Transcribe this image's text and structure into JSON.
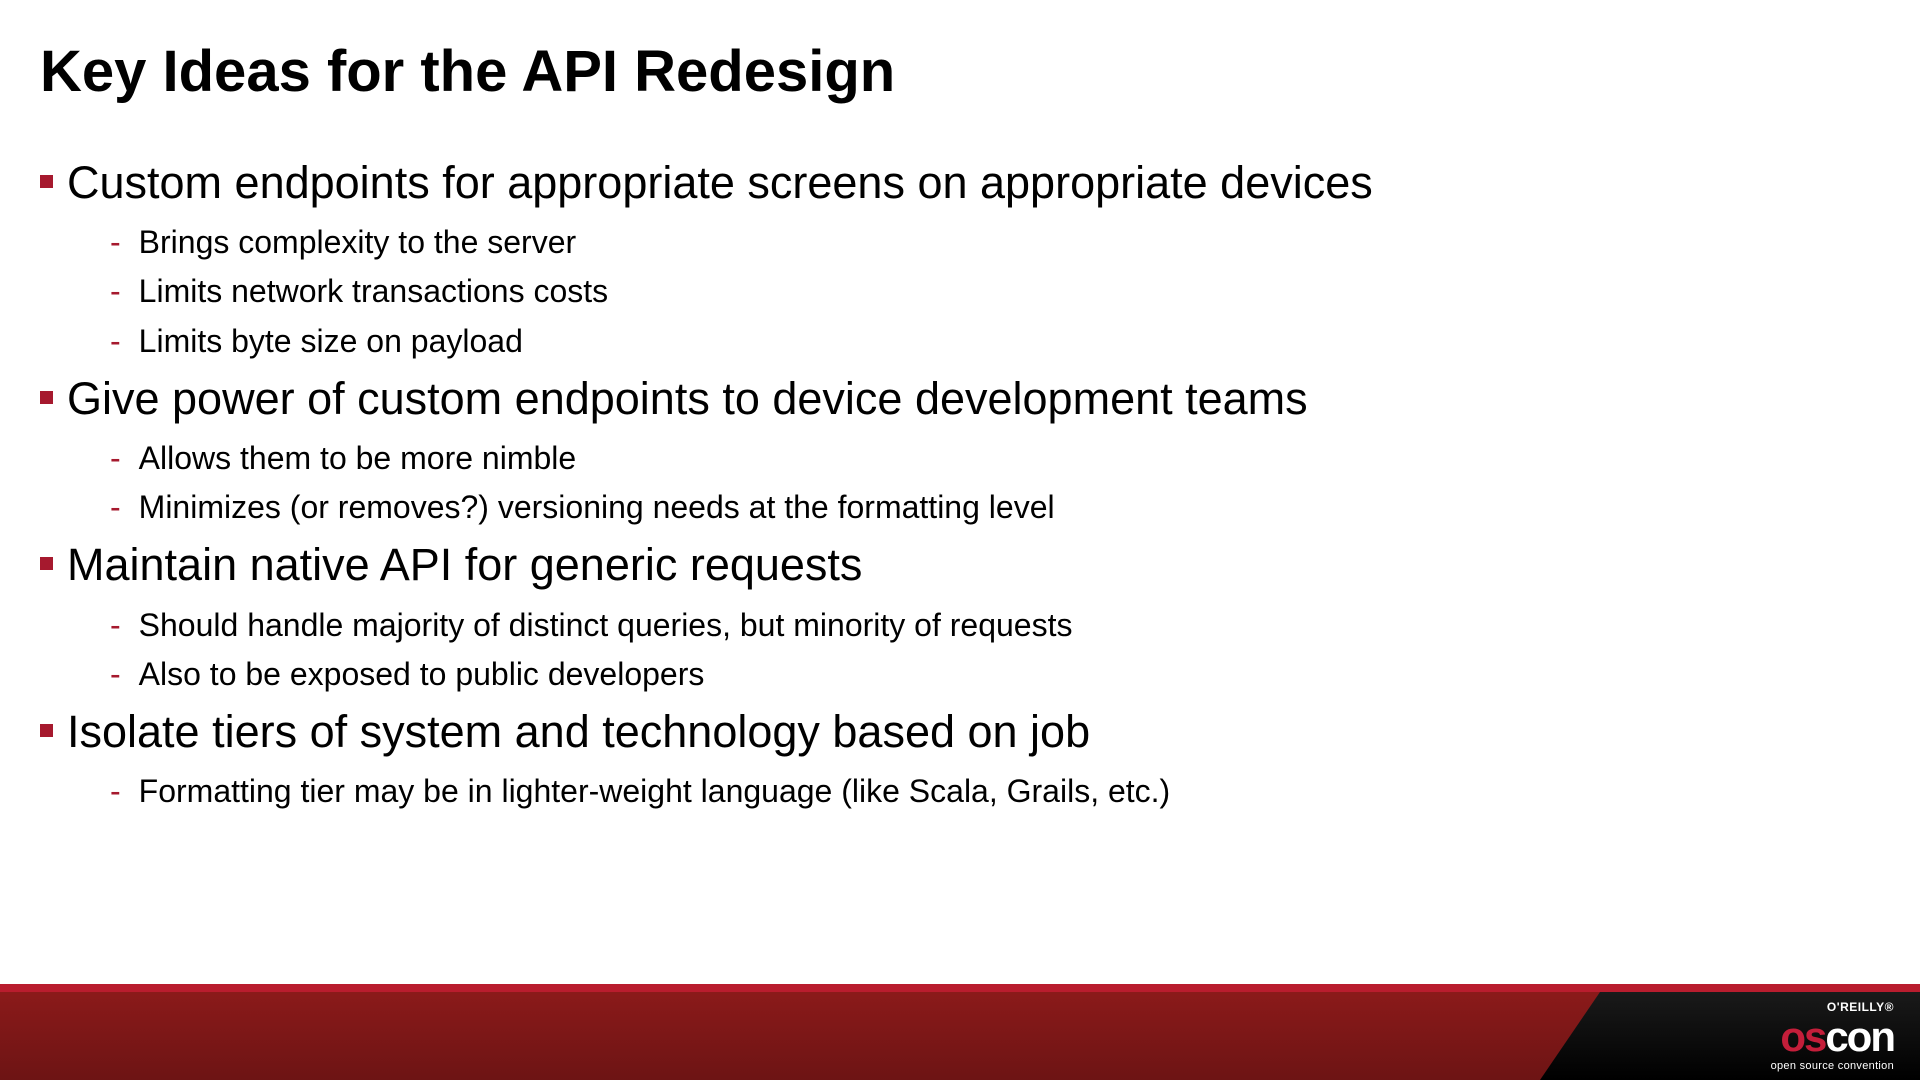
{
  "title": "Key Ideas for the API Redesign",
  "bullets": [
    {
      "main": "Custom endpoints for appropriate screens on appropriate devices",
      "subs": [
        "Brings complexity to the server",
        "Limits network transactions costs",
        "Limits byte size on payload"
      ]
    },
    {
      "main": "Give power of custom endpoints to device development teams",
      "subs": [
        "Allows them to be more nimble",
        "Minimizes (or removes?) versioning needs at the formatting level"
      ]
    },
    {
      "main": "Maintain native API for generic requests",
      "subs": [
        "Should handle majority of distinct queries, but minority of requests",
        "Also to be exposed to public developers"
      ]
    },
    {
      "main": "Isolate tiers of system and technology based on job",
      "subs": [
        "Formatting tier may be in lighter-weight language (like Scala, Grails, etc.)"
      ]
    }
  ],
  "footer": {
    "oreilly": "O'REILLY®",
    "brand_os": "os",
    "brand_con": "con",
    "tagline": "open source convention"
  }
}
